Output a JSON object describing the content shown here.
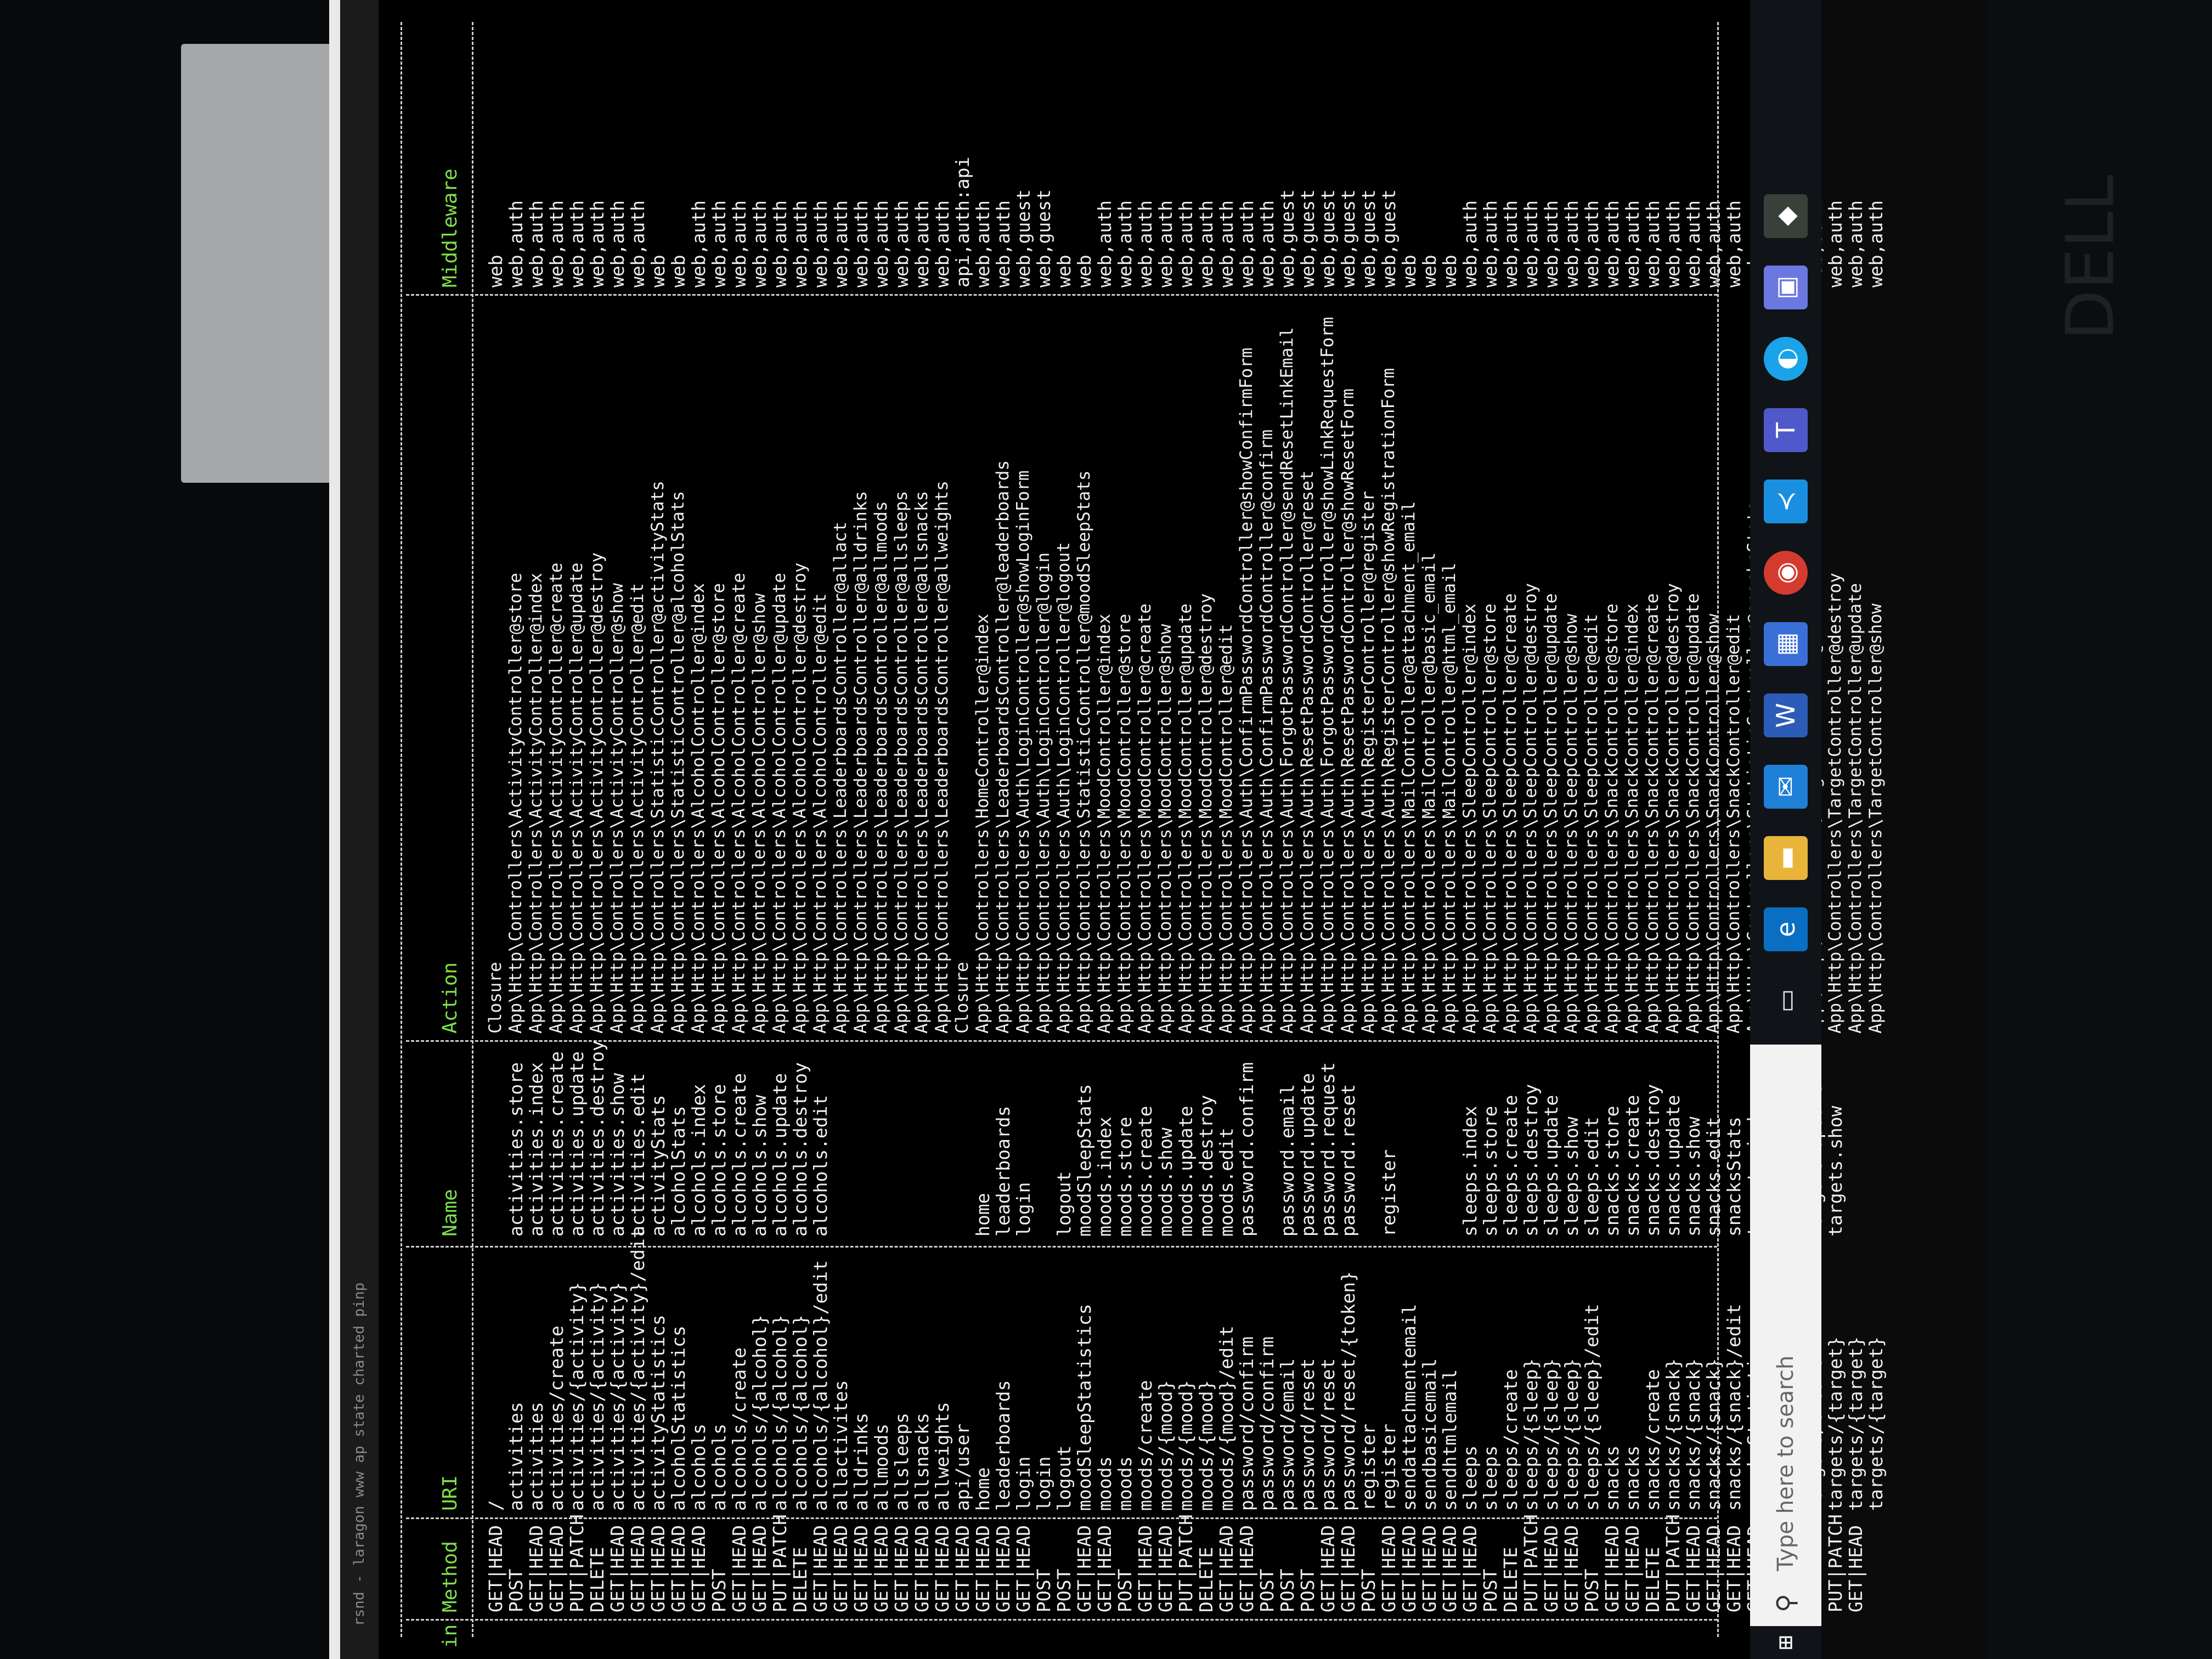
{
  "window": {
    "title": "rsnd - laragon www ap state charted pinp"
  },
  "table": {
    "headers": {
      "domain": "in",
      "method": "Method",
      "uri": "URI",
      "name": "Name",
      "action": "Action",
      "middleware": "Middleware"
    },
    "methods": "GET|HEAD\nPOST\nGET|HEAD\nGET|HEAD\nPUT|PATCH\nDELETE\nGET|HEAD\nGET|HEAD\nGET|HEAD\nGET|HEAD\nGET|HEAD\nPOST\nGET|HEAD\nGET|HEAD\nPUT|PATCH\nDELETE\nGET|HEAD\nGET|HEAD\nGET|HEAD\nGET|HEAD\nGET|HEAD\nGET|HEAD\nGET|HEAD\nGET|HEAD\nGET|HEAD\nGET|HEAD\nGET|HEAD\nPOST\nPOST\nGET|HEAD\nGET|HEAD\nPOST\nGET|HEAD\nGET|HEAD\nPUT|PATCH\nDELETE\nGET|HEAD\nGET|HEAD\nPOST\nPOST\nPOST\nGET|HEAD\nGET|HEAD\nPOST\nGET|HEAD\nGET|HEAD\nGET|HEAD\nGET|HEAD\nGET|HEAD\nPOST\nDELETE\nPUT|PATCH\nGET|HEAD\nGET|HEAD\nPOST\nGET|HEAD\nGET|HEAD\nDELETE\nPUT|PATCH\nGET|HEAD\nGET|HEAD\nGET|HEAD\nGET|HEAD\nPOST\nGET|HEAD\nDELETE\nPUT|PATCH\nGET|HEAD",
    "uris": "/\nactivities\nactivities\nactivities/create\nactivities/{activity}\nactivities/{activity}\nactivities/{activity}\nactivities/{activity}/edit\nactivityStatistics\nalcoholStatistics\nalcohols\nalcohols\nalcohols/create\nalcohols/{alcohol}\nalcohols/{alcohol}\nalcohols/{alcohol}\nalcohols/{alcohol}/edit\nallactivites\nalldrinks\nallmoods\nallsleeps\nallsnacks\nallweights\napi/user\nhome\nleaderboards\nlogin\nlogin\nlogout\nmoodSleepStatistics\nmoods\nmoods\nmoods/create\nmoods/{mood}\nmoods/{mood}\nmoods/{mood}\nmoods/{mood}/edit\npassword/confirm\npassword/confirm\npassword/email\npassword/reset\npassword/reset\npassword/reset/{token}\nregister\nregister\nsendattachmentemail\nsendbasicemail\nsendhtmlemail\nsleeps\nsleeps\nsleeps/create\nsleeps/{sleep}\nsleeps/{sleep}\nsleeps/{sleep}\nsleeps/{sleep}/edit\nsnacks\nsnacks\nsnacks/create\nsnacks/{snack}\nsnacks/{snack}\nsnacks/{snack}\nsnacks/{snack}/edit\nsnacksStatistics\ntargets\ntargets\ntargets/create\ntargets/{target}\ntargets/{target}\ntargets/{target}",
    "names": "\nactivities.store\nactivities.index\nactivities.create\nactivities.update\nactivities.destroy\nactivities.show\nactivities.edit\nactivityStats\nalcoholStats\nalcohols.index\nalcohols.store\nalcohols.create\nalcohols.show\nalcohols.update\nalcohols.destroy\nalcohols.edit\n\n\n\n\n\n\n\nhome\nleaderboards\nlogin\n\nlogout\nmoodSleepStats\nmoods.index\nmoods.store\nmoods.create\nmoods.show\nmoods.update\nmoods.destroy\nmoods.edit\npassword.confirm\n\npassword.email\npassword.update\npassword.request\npassword.reset\n\nregister\n\n\n\nsleeps.index\nsleeps.store\nsleeps.create\nsleeps.destroy\nsleeps.update\nsleeps.show\nsleeps.edit\nsnacks.store\nsnacks.create\nsnacks.destroy\nsnacks.update\nsnacks.show\nsnacks.edit\nsnacksStats\ntargets.index\ntargets.store\ntargets.destroy\ntargets.update\ntargets.show",
    "actions": "Closure\nApp\\Http\\Controllers\\ActivityController@store\nApp\\Http\\Controllers\\ActivityController@index\nApp\\Http\\Controllers\\ActivityController@create\nApp\\Http\\Controllers\\ActivityController@update\nApp\\Http\\Controllers\\ActivityController@destroy\nApp\\Http\\Controllers\\ActivityController@show\nApp\\Http\\Controllers\\ActivityController@edit\nApp\\Http\\Controllers\\StatisticController@activityStats\nApp\\Http\\Controllers\\StatisticController@alcoholStats\nApp\\Http\\Controllers\\AlcoholController@index\nApp\\Http\\Controllers\\AlcoholController@store\nApp\\Http\\Controllers\\AlcoholController@create\nApp\\Http\\Controllers\\AlcoholController@show\nApp\\Http\\Controllers\\AlcoholController@update\nApp\\Http\\Controllers\\AlcoholController@destroy\nApp\\Http\\Controllers\\AlcoholController@edit\nApp\\Http\\Controllers\\LeaderboardsController@allact\nApp\\Http\\Controllers\\LeaderboardsController@alldrinks\nApp\\Http\\Controllers\\LeaderboardsController@allmoods\nApp\\Http\\Controllers\\LeaderboardsController@allsleeps\nApp\\Http\\Controllers\\LeaderboardsController@allsnacks\nApp\\Http\\Controllers\\LeaderboardsController@allweights\nClosure\nApp\\Http\\Controllers\\HomeController@index\nApp\\Http\\Controllers\\LeaderboardsController@leaderboards\nApp\\Http\\Controllers\\Auth\\LoginController@showLoginForm\nApp\\Http\\Controllers\\Auth\\LoginController@login\nApp\\Http\\Controllers\\Auth\\LoginController@logout\nApp\\Http\\Controllers\\StatisticController@moodSleepStats\nApp\\Http\\Controllers\\MoodController@index\nApp\\Http\\Controllers\\MoodController@store\nApp\\Http\\Controllers\\MoodController@create\nApp\\Http\\Controllers\\MoodController@show\nApp\\Http\\Controllers\\MoodController@update\nApp\\Http\\Controllers\\MoodController@destroy\nApp\\Http\\Controllers\\MoodController@edit\nApp\\Http\\Controllers\\Auth\\ConfirmPasswordController@showConfirmForm\nApp\\Http\\Controllers\\Auth\\ConfirmPasswordController@confirm\nApp\\Http\\Controllers\\Auth\\ForgotPasswordController@sendResetLinkEmail\nApp\\Http\\Controllers\\Auth\\ResetPasswordController@reset\nApp\\Http\\Controllers\\Auth\\ForgotPasswordController@showLinkRequestForm\nApp\\Http\\Controllers\\Auth\\ResetPasswordController@showResetForm\nApp\\Http\\Controllers\\Auth\\RegisterController@register\nApp\\Http\\Controllers\\Auth\\RegisterController@showRegistrationForm\nApp\\Http\\Controllers\\MailController@attachment_email\nApp\\Http\\Controllers\\MailController@basic_email\nApp\\Http\\Controllers\\MailController@html_email\nApp\\Http\\Controllers\\SleepController@index\nApp\\Http\\Controllers\\SleepController@store\nApp\\Http\\Controllers\\SleepController@create\nApp\\Http\\Controllers\\SleepController@destroy\nApp\\Http\\Controllers\\SleepController@update\nApp\\Http\\Controllers\\SleepController@show\nApp\\Http\\Controllers\\SleepController@edit\nApp\\Http\\Controllers\\SnackController@store\nApp\\Http\\Controllers\\SnackController@index\nApp\\Http\\Controllers\\SnackController@create\nApp\\Http\\Controllers\\SnackController@destroy\nApp\\Http\\Controllers\\SnackController@update\nApp\\Http\\Controllers\\SnackController@show\nApp\\Http\\Controllers\\SnackController@edit\nApp\\Http\\Controllers\\StatisticController@snacksStats\nApp\\Http\\Controllers\\TargetController@index\nApp\\Http\\Controllers\\TargetController@store\nApp\\Http\\Controllers\\TargetController@create\nApp\\Http\\Controllers\\TargetController@destroy\nApp\\Http\\Controllers\\TargetController@update\nApp\\Http\\Controllers\\TargetController@show",
    "middleware": "web\nweb,auth\nweb,auth\nweb,auth\nweb,auth\nweb,auth\nweb,auth\nweb,auth\nweb\nweb\nweb,auth\nweb,auth\nweb,auth\nweb,auth\nweb,auth\nweb,auth\nweb,auth\nweb,auth\nweb,auth\nweb,auth\nweb,auth\nweb,auth\nweb,auth\napi,auth:api\nweb,auth\nweb,auth\nweb,guest\nweb,guest\nweb\nweb\nweb,auth\nweb,auth\nweb,auth\nweb,auth\nweb,auth\nweb,auth\nweb,auth\nweb,auth\nweb,auth\nweb,guest\nweb,guest\nweb,guest\nweb,guest\nweb,guest\nweb,guest\nweb\nweb\nweb\nweb,auth\nweb,auth\nweb,auth\nweb,auth\nweb,auth\nweb,auth\nweb,auth\nweb,auth\nweb,auth\nweb,auth\nweb,auth\nweb,auth\nweb,auth\nweb,auth\nweb\nweb,auth\nweb,auth\nweb,auth\nweb,auth\nweb,auth\nweb,auth"
  },
  "taskbar": {
    "search_placeholder": "Type here to search",
    "icons": [
      "windows-icon",
      "task-view-icon",
      "edge-icon",
      "file-explorer-icon",
      "mail-icon",
      "word-icon",
      "store-icon",
      "chrome-icon",
      "vscode-icon",
      "teams-icon",
      "browser-icon",
      "notes-icon",
      "app-icon"
    ]
  },
  "colors": {
    "header_green": "#7ee04b",
    "terminal_bg": "#000000",
    "text": "#f0f0f0",
    "taskbar_bg": "#101318"
  }
}
